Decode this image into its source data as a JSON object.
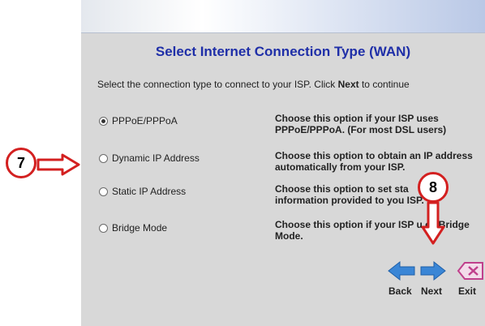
{
  "header": {
    "title": "Select Internet Connection Type (WAN)",
    "instruction_prefix": "Select the connection type to connect to your ISP. Click ",
    "instruction_bold": "Next",
    "instruction_suffix": " to continue"
  },
  "options": [
    {
      "label": "PPPoE/PPPoA",
      "selected": true,
      "desc1": "Choose this option if your ISP uses",
      "desc2": "PPPoE/PPPoA. (For most DSL users)"
    },
    {
      "label": "Dynamic IP Address",
      "selected": false,
      "desc1": "Choose this option to obtain an IP address",
      "desc2": "automatically from your ISP."
    },
    {
      "label": "Static IP Address",
      "selected": false,
      "desc1": "Choose this option to set sta",
      "desc2": "information provided to you  ISP."
    },
    {
      "label": "Bridge Mode",
      "selected": false,
      "desc1": "Choose this option if your ISP u  es Bridge",
      "desc2": "Mode."
    }
  ],
  "nav": {
    "back_label": "Back",
    "next_label": "Next",
    "exit_label": "Exit"
  },
  "annotations": {
    "step7": "7",
    "step8": "8"
  },
  "colors": {
    "title": "#1f2fa8",
    "arrow_blue": "#3a86d6",
    "annotation_red": "#d32020",
    "exit_pink": "#c0408c"
  }
}
